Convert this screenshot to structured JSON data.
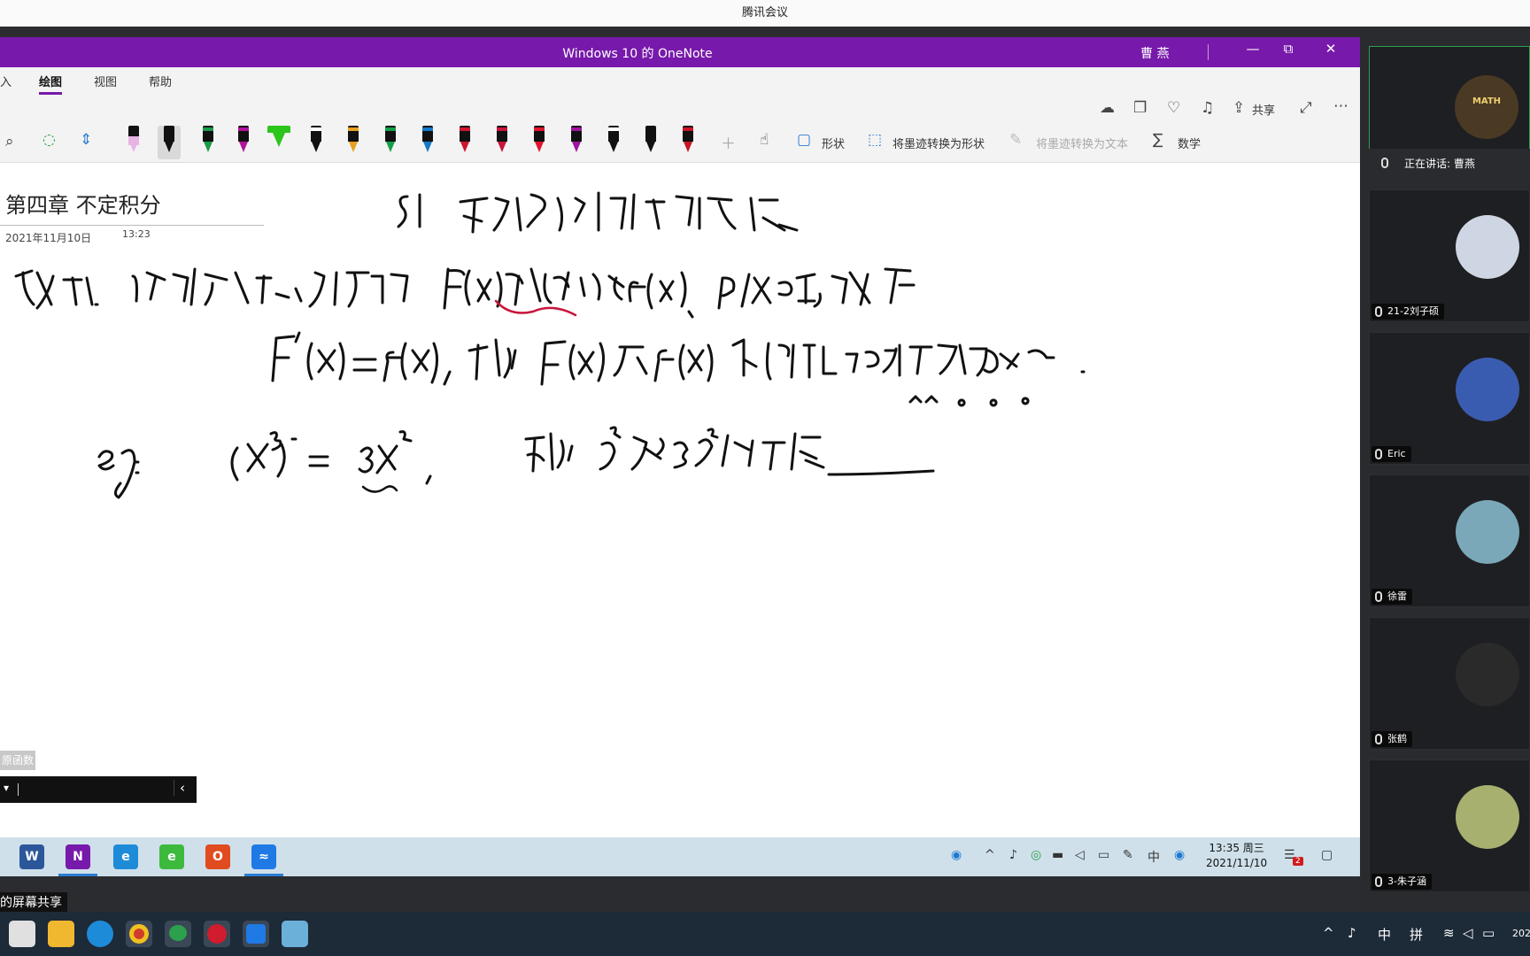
{
  "outer_window": {
    "title": "腾讯会议"
  },
  "onenote": {
    "title": "Windows 10 的 OneNote",
    "user": "曹 燕",
    "window_buttons": {
      "minimize": "—",
      "restore": "⧉",
      "close": "✕"
    },
    "tabs": [
      {
        "label": "入"
      },
      {
        "label": "绘图",
        "active": true
      },
      {
        "label": "视图"
      },
      {
        "label": "帮助"
      }
    ],
    "right_tools": {
      "share": "共享"
    },
    "ribbon_buttons": {
      "shapes": "形状",
      "ink_to_shape": "将墨迹转换为形状",
      "ink_to_text": "将墨迹转换为文本",
      "math": "数学"
    },
    "pens": [
      {
        "color": "#111111",
        "cap": "#e8b4e4",
        "type": "highlighter-black"
      },
      {
        "color": "#111111",
        "cap": "#111111",
        "selected": true
      },
      {
        "color": "#111111",
        "cap": "#1a9a4a"
      },
      {
        "color": "#111111",
        "cap": "#b0149a"
      },
      {
        "color": "#111111",
        "cap": "#2cc51c",
        "type": "highlighter-green"
      },
      {
        "color": "#111111",
        "cap": "#ffffff",
        "type": "galaxy"
      },
      {
        "color": "#111111",
        "cap": "#e8a020"
      },
      {
        "color": "#111111",
        "cap": "#14a04a"
      },
      {
        "color": "#111111",
        "cap": "#1479c8"
      },
      {
        "color": "#111111",
        "cap": "#d01430"
      },
      {
        "color": "#111111",
        "cap": "#c8143c"
      },
      {
        "color": "#111111",
        "cap": "#e0142c"
      },
      {
        "color": "#111111",
        "cap": "#a014a0"
      },
      {
        "color": "#111111",
        "cap": "#ffffff",
        "type": "galaxy"
      },
      {
        "color": "#111111",
        "cap": "#111111"
      },
      {
        "color": "#111111",
        "cap": "#c81428"
      }
    ],
    "page": {
      "title": "第四章 不定积分",
      "date": "2021年11月10日",
      "time": "13:23"
    },
    "ime": {
      "popup": "原函数"
    }
  },
  "inner_taskbar": {
    "apps": [
      {
        "name": "word",
        "glyph": "W",
        "color": "#2b579a"
      },
      {
        "name": "onenote",
        "glyph": "N",
        "color": "#7719aa",
        "active": true
      },
      {
        "name": "ie",
        "glyph": "e",
        "color": "#1e8bd8"
      },
      {
        "name": "edge-legacy",
        "glyph": "e",
        "color": "#3dba3d"
      },
      {
        "name": "office",
        "glyph": "O",
        "color": "#e04b1f"
      },
      {
        "name": "tencent-meeting",
        "glyph": "≈",
        "color": "#1f7ae6",
        "active": true
      }
    ],
    "clock": {
      "time": "13:35 周三",
      "date": "2021/11/10"
    },
    "tray_ime": "中",
    "notif_badge": "2"
  },
  "share_label": "的屏幕共享",
  "participants": {
    "speaking": "正在讲话: 曹燕",
    "list": [
      {
        "name": "",
        "avatar_color": "#6b5a3a",
        "avatar_text": "MATH"
      },
      {
        "name": "21-2刘子硕",
        "avatar_color": "#cfd6e3"
      },
      {
        "name": "Eric",
        "avatar_color": "#3a5cb0"
      },
      {
        "name": "徐雷",
        "avatar_color": "#7aa8b8"
      },
      {
        "name": "张鹤",
        "avatar_color": "#2a2a2a"
      },
      {
        "name": "3-朱子涵",
        "avatar_color": "#a8b070"
      }
    ]
  },
  "outer_taskbar": {
    "tray_ime1": "中",
    "tray_ime2": "拼",
    "year_partial": "202"
  }
}
